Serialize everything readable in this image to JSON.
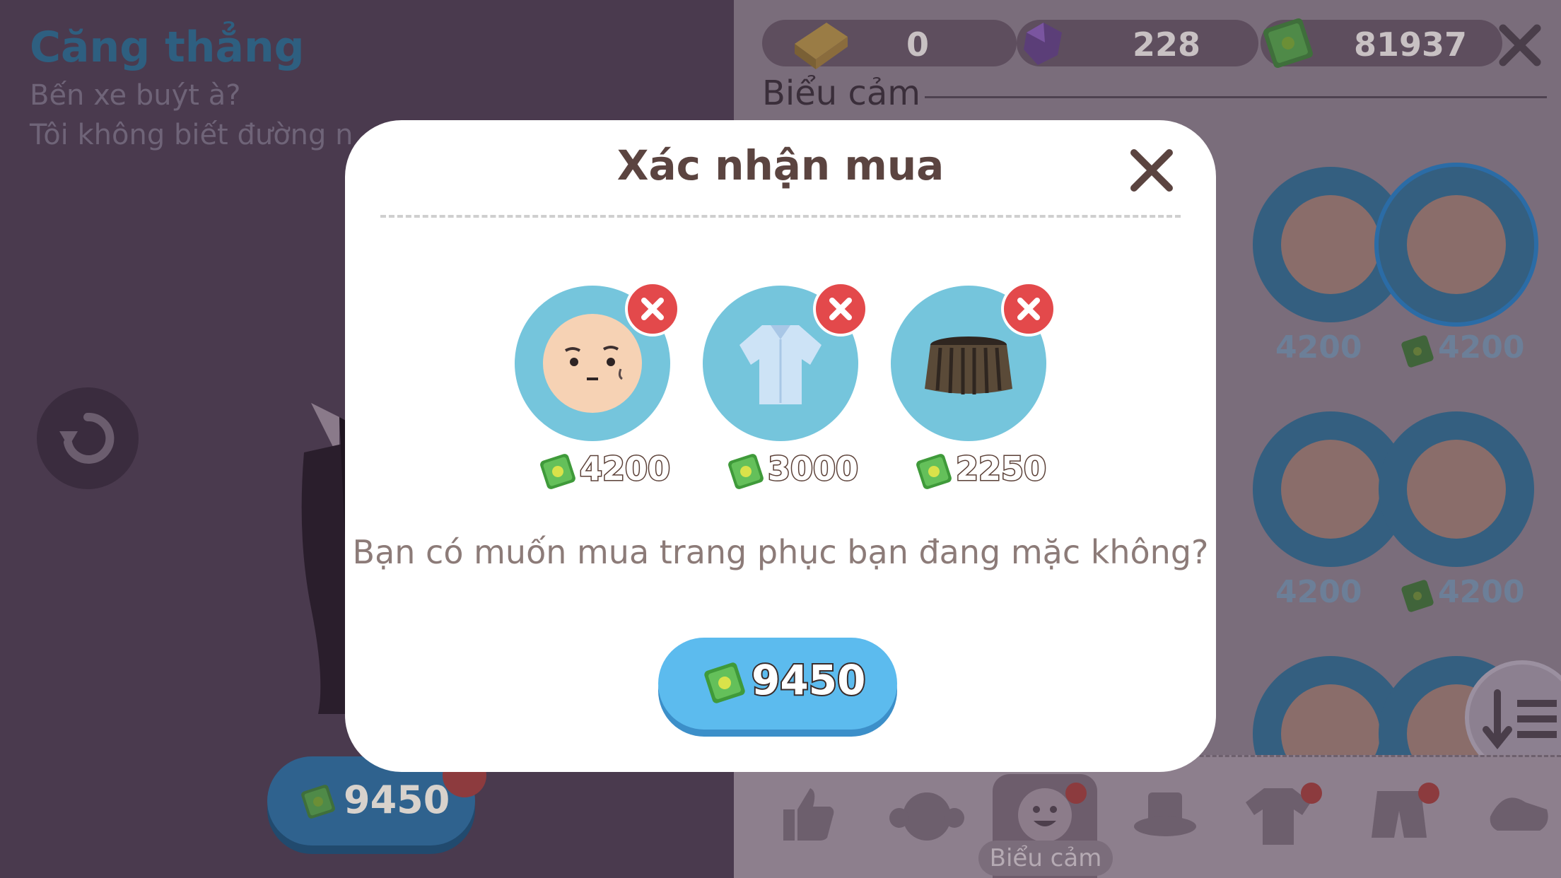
{
  "scene": {
    "title": "Căng thẳng",
    "line1": "Bến xe buýt à?",
    "line2": "Tôi không biết đường n"
  },
  "currencies": {
    "gold": "0",
    "gem": "228",
    "cash": "81937"
  },
  "shop": {
    "section_title": "Biểu cảm",
    "face_prices": [
      "4200",
      "4200",
      "4200",
      "4200"
    ],
    "active_tab_label": "Biểu cảm",
    "total_price": "9450"
  },
  "modal": {
    "title": "Xác nhận mua",
    "items": [
      {
        "name": "face",
        "price": "4200"
      },
      {
        "name": "shirt",
        "price": "3000"
      },
      {
        "name": "skirt",
        "price": "2250"
      }
    ],
    "message": "Bạn có muốn mua trang phục bạn đang mặc không?",
    "buy_price": "9450"
  },
  "colors": {
    "modal_bg": "#ffffff",
    "item_bg": "#75c5dc",
    "remove_red": "#e3494b",
    "buy_button": "#5cbbee",
    "money_green": "#5db84a"
  }
}
